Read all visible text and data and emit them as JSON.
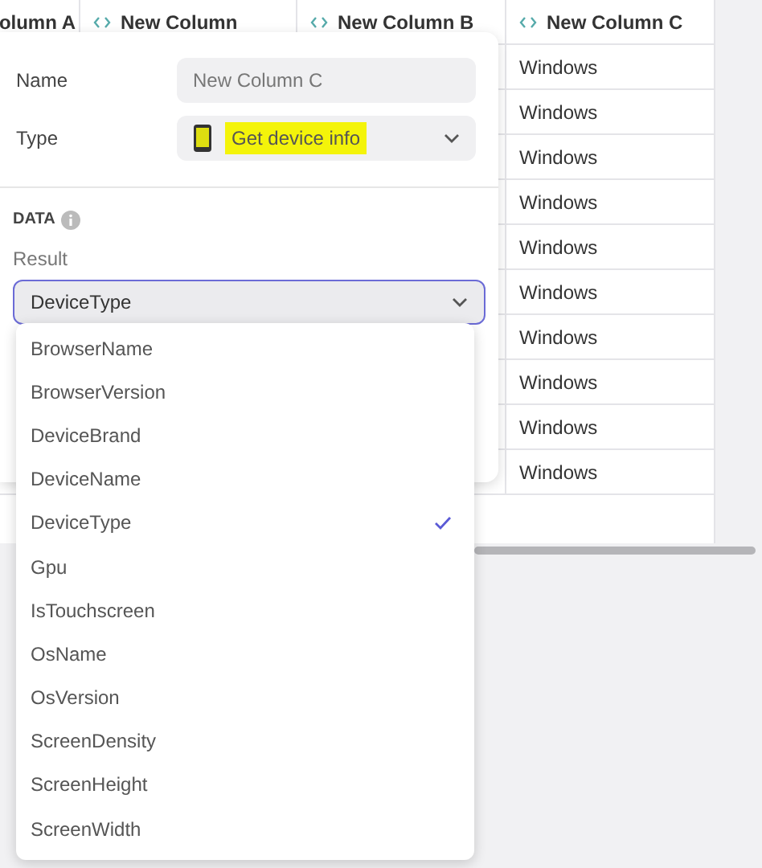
{
  "table": {
    "columns": [
      {
        "label": "olumn A",
        "icon": false
      },
      {
        "label": "New Column",
        "icon": true
      },
      {
        "label": "New Column B",
        "icon": true
      },
      {
        "label": "New Column C",
        "icon": true
      }
    ],
    "rows": [
      {
        "column_c": "Windows"
      },
      {
        "column_c": "Windows"
      },
      {
        "column_c": "Windows"
      },
      {
        "column_c": "Windows"
      },
      {
        "column_c": "Windows"
      },
      {
        "column_c": "Windows"
      },
      {
        "column_c": "Windows"
      },
      {
        "column_c": "Windows"
      },
      {
        "column_c": "Windows"
      },
      {
        "column_c": "Windows"
      }
    ]
  },
  "panel": {
    "fields": [
      {
        "label": "Name",
        "kind": "text",
        "value": "New Column C",
        "highlighted": false
      },
      {
        "label": "Type",
        "kind": "select",
        "value": "Get device info",
        "highlighted": true
      }
    ],
    "section": "DATA",
    "result_label": "Result",
    "result_value": "DeviceType",
    "options": [
      {
        "label": "BrowserName",
        "selected": false
      },
      {
        "label": "BrowserVersion",
        "selected": false
      },
      {
        "label": "DeviceBrand",
        "selected": false
      },
      {
        "label": "DeviceName",
        "selected": false
      },
      {
        "label": "DeviceType",
        "selected": true
      },
      {
        "label": "Gpu",
        "selected": false
      },
      {
        "label": "IsTouchscreen",
        "selected": false
      },
      {
        "label": "OsName",
        "selected": false
      },
      {
        "label": "OsVersion",
        "selected": false
      },
      {
        "label": "ScreenDensity",
        "selected": false
      },
      {
        "label": "ScreenHeight",
        "selected": false
      },
      {
        "label": "ScreenWidth",
        "selected": false
      }
    ]
  }
}
